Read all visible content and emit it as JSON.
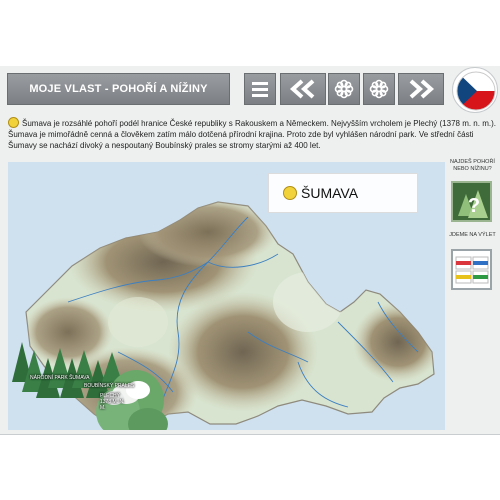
{
  "header": {
    "title": "MOJE VLAST - POHOŘÍ A NÍŽINY",
    "buttons": [
      {
        "name": "menu-icon"
      },
      {
        "name": "double-chevron-left-icon"
      },
      {
        "name": "flower-icon"
      },
      {
        "name": "flower-icon"
      },
      {
        "name": "double-chevron-right-icon"
      }
    ],
    "flag": {
      "name": "czech-flag-icon",
      "colors": [
        "#ffffff",
        "#d7141a",
        "#11457e"
      ]
    }
  },
  "description": "Šumava je rozsáhlé pohoří podél hranice České republiky s Rakouskem a Německem. Nejvyšším vrcholem je Plechý (1378 m. n. m.). Šumava je mimořádně cenná a člověkem zatím málo dotčená přírodní krajina. Proto zde byl vyhlášen národní park. Ve střední části Šumavy se nachází divoký a nespoutaný Boubínský prales se stromy starými až 400 let.",
  "map": {
    "callout_label": "ŠUMAVA",
    "places": [
      {
        "label": "NÁRODNÍ PARK ŠUMAVA"
      },
      {
        "label": "BOUBÍNSKÝ PRALES"
      },
      {
        "label": "PLECHÝ 1378 M. N. M."
      }
    ]
  },
  "side_panel": {
    "find_label": "NAJDEŠ POHOŘÍ NEBO NÍŽINU?",
    "trip_label": "JDEME NA VÝLET",
    "trip_colors": [
      "#d9363e",
      "#2f6fc4",
      "#e7c21d",
      "#2e9a44"
    ]
  },
  "colors": {
    "toolbar": "#8a8d90",
    "highland": "#8c7b5e",
    "lowland": "#d8e4d0",
    "forest": "#3f7f47",
    "water": "#cfe1ef"
  }
}
